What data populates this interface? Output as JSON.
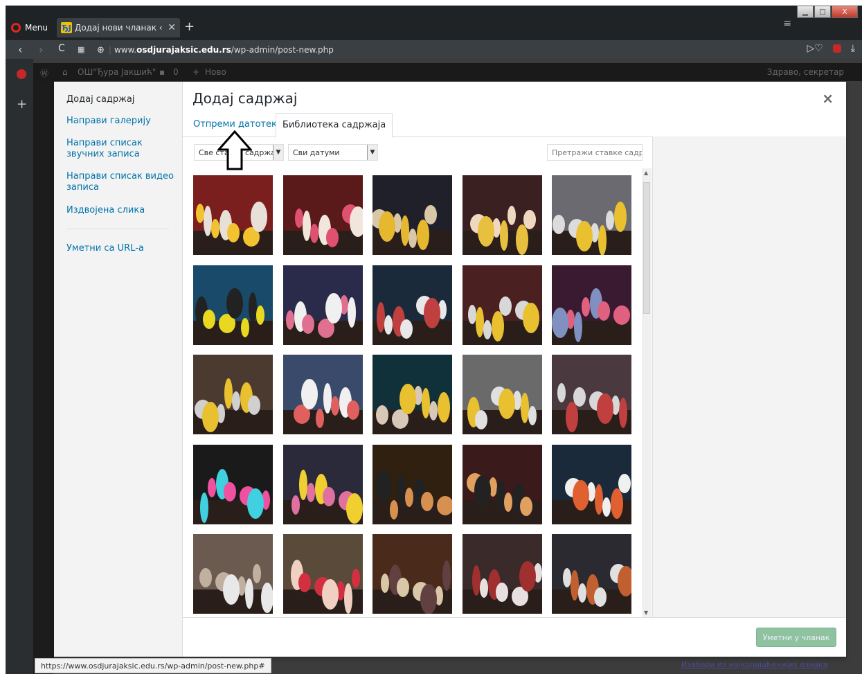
{
  "browser": {
    "menu_label": "Menu",
    "tab_title": "Додај нови чланак ‹ ОШ",
    "favicon": "ЂЈ",
    "url_prefix": "www.",
    "url_host": "osdjurajaksic.edu.rs",
    "url_path": "/wp-admin/post-new.php",
    "status_url": "https://www.osdjurajaksic.edu.rs/wp-admin/post-new.php#"
  },
  "wp_bar": {
    "site_name": "ОШ\"Ђура Јакшић\"",
    "comments_count": "0",
    "new_label": "Ново",
    "greeting": "Здраво, секретар"
  },
  "modal": {
    "title": "Додај садржај",
    "close": "×",
    "menu": [
      "Додај садржај",
      "Направи галерију",
      "Направи списак звучних записа",
      "Направи списак видео записа",
      "Издвојена слика",
      "Уметни са URL-а"
    ],
    "tabs": {
      "upload": "Отпреми датотеке",
      "library": "Библиотека садржаја"
    },
    "filter_type": "Све ставке садржаја",
    "filter_date": "Сви датуми",
    "search_placeholder": "Претражи ставке садржаја",
    "insert_button": "Уметни у чланак"
  },
  "bottom_link": "Изабери из најкоришћенијих ознака",
  "colors": {
    "link": "#0073aa",
    "primary_disabled": "#8fc3a0"
  }
}
